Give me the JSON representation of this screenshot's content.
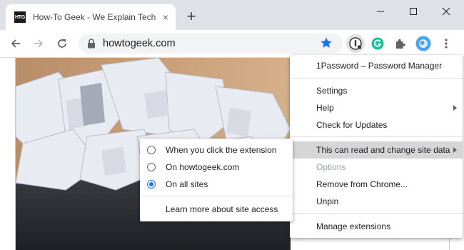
{
  "tab": {
    "favicon_text": "HTG",
    "title": "How-To Geek - We Explain Techn",
    "close_glyph": "×"
  },
  "new_tab_glyph": "+",
  "address": {
    "url": "howtogeek.com"
  },
  "colors": {
    "accent": "#1a73e8",
    "grammarly": "#15c39a",
    "profile": "#4aa3f0",
    "tabstrip": "#dee1e6"
  },
  "icons": {
    "back": "arrow-left-icon",
    "forward": "arrow-right-icon",
    "reload": "reload-icon",
    "lock": "lock-icon",
    "bookmark": "star-icon",
    "onepassword": "1password-extension-icon",
    "grammarly": "grammarly-extension-icon",
    "extensions": "puzzle-icon",
    "profile": "profile-avatar-icon",
    "menu": "kebab-menu-icon"
  },
  "extension_menu": {
    "header": "1Password – Password Manager",
    "settings": "Settings",
    "help": "Help",
    "check_updates": "Check for Updates",
    "site_data": "This can read and change site data",
    "options": "Options",
    "remove": "Remove from Chrome...",
    "unpin": "Unpin",
    "manage": "Manage extensions"
  },
  "site_access_menu": {
    "options": [
      {
        "label": "When you click the extension",
        "selected": false
      },
      {
        "label": "On howtogeek.com",
        "selected": false
      },
      {
        "label": "On all sites",
        "selected": true
      }
    ],
    "learn_more": "Learn more about site access"
  }
}
